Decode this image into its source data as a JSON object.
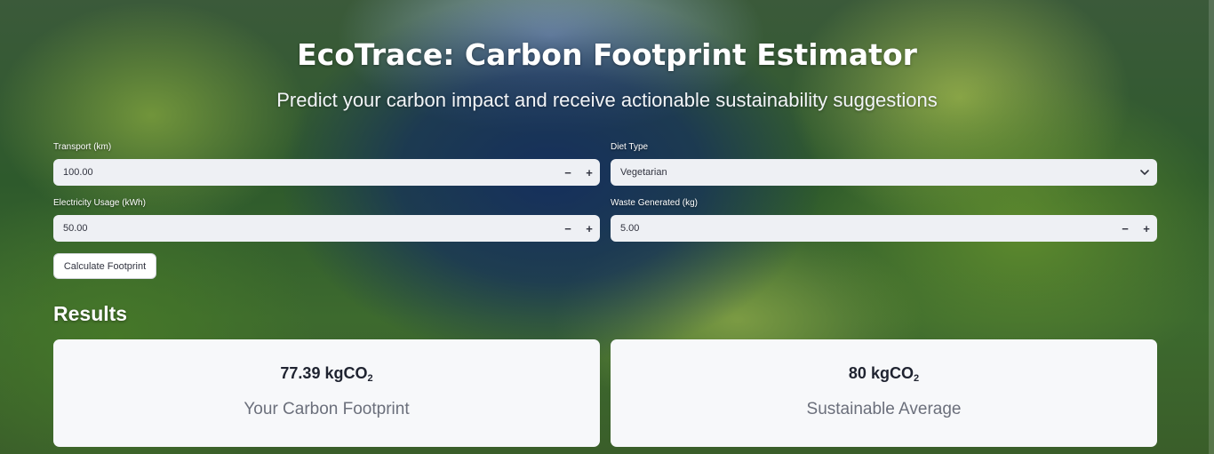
{
  "header": {
    "title": "EcoTrace: Carbon Footprint Estimator",
    "subtitle": "Predict your carbon impact and receive actionable sustainability suggestions"
  },
  "form": {
    "transport": {
      "label": "Transport (km)",
      "value": "100.00",
      "minus": "−",
      "plus": "+"
    },
    "diet": {
      "label": "Diet Type",
      "value": "Vegetarian"
    },
    "electricity": {
      "label": "Electricity Usage (kWh)",
      "value": "50.00",
      "minus": "−",
      "plus": "+"
    },
    "waste": {
      "label": "Waste Generated (kg)",
      "value": "5.00",
      "minus": "−",
      "plus": "+"
    },
    "calculate_label": "Calculate Footprint"
  },
  "results": {
    "title": "Results",
    "footprint": {
      "value": "77.39 kgCO",
      "sub": "2",
      "caption": "Your Carbon Footprint"
    },
    "average": {
      "value": "80 kgCO",
      "sub": "2",
      "caption": "Sustainable Average"
    }
  },
  "icons": {
    "dropdown": "chevron-down-icon"
  }
}
